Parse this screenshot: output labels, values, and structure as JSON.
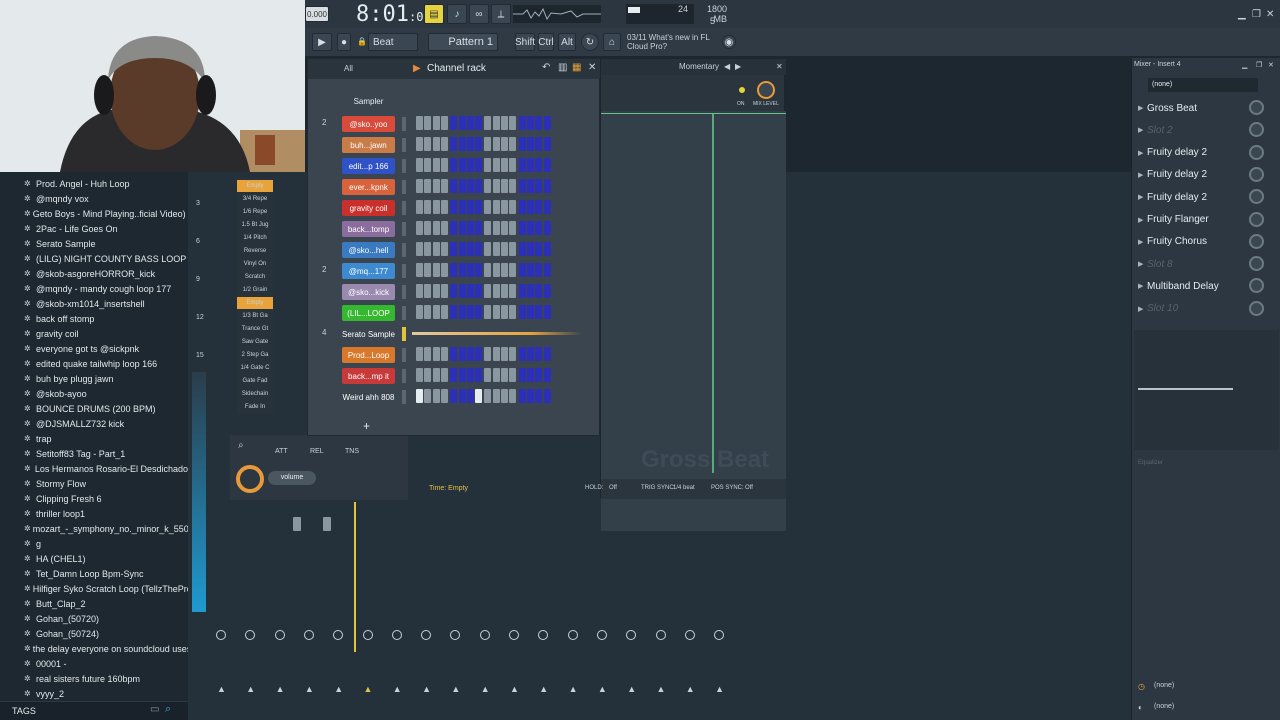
{
  "topbar": {
    "time": "8:01",
    "time_small": ":00",
    "tempo": "0.000",
    "cpu": "24",
    "ram": "1800 MB",
    "poly": "5",
    "news_date": "03/11",
    "news_text": "What's new in FL Cloud Pro?"
  },
  "toolbar": {
    "mode": "Beat",
    "pattern": "Pattern 1",
    "shift": "Shift",
    "ctrl": "Ctrl",
    "alt": "Alt"
  },
  "channel_rack": {
    "filter": "All",
    "title": "Channel rack",
    "sampler": "Sampler",
    "channels": [
      {
        "num": "2",
        "label": "@sko..yoo",
        "color": "#d84a3a"
      },
      {
        "num": "",
        "label": "buh...jawn",
        "color": "#c97b48"
      },
      {
        "num": "",
        "label": "edit...p 166",
        "color": "#2f52c8"
      },
      {
        "num": "",
        "label": "ever...kpnk",
        "color": "#d8623a"
      },
      {
        "num": "",
        "label": "gravity coil",
        "color": "#c9302c"
      },
      {
        "num": "",
        "label": "back...tomp",
        "color": "#8a6d9c"
      },
      {
        "num": "",
        "label": "@sko...hell",
        "color": "#3a7ac0"
      },
      {
        "num": "2",
        "label": "@mq...177",
        "color": "#3e8ad0"
      },
      {
        "num": "",
        "label": "@sko...kick",
        "color": "#9a8ab0"
      },
      {
        "num": "",
        "label": "(LIL...LOOP",
        "color": "#35b830"
      },
      {
        "num": "4",
        "label": "Serato Sample",
        "color": "#3a4550"
      },
      {
        "num": "",
        "label": "Prod...Loop",
        "color": "#d8782a"
      },
      {
        "num": "",
        "label": "back...mp it",
        "color": "#c83a3a"
      },
      {
        "num": "",
        "label": "Weird ahh 808",
        "color": "#3a4550"
      }
    ]
  },
  "side_effects": [
    "Empty",
    "3/4 Repe",
    "1/6 Repe",
    "1.5 Bt Jug",
    "1/4 Pitch",
    "Reverse",
    "Vinyl On",
    "Scratch",
    "1/2 Grain",
    "Empty",
    "1/3 Bt Ga",
    "Trance Gt",
    "Saw Gate",
    "2 Step Ga",
    "1/4 Gate C",
    "Gate Fad",
    "Sidechain",
    "Fade In"
  ],
  "envelope": {
    "att": "ATT",
    "rel": "REL",
    "tns": "TNS",
    "volume": "volume"
  },
  "grossbeat": {
    "header": "Momentary",
    "on": "ON",
    "mix": "MIX LEVEL",
    "watermark": "Gross Beat",
    "time": "Time: Empty",
    "hold_label": "HOLD:",
    "hold": "Off",
    "trig_label": "TRIG SYNC:",
    "trig": "1/4 beat",
    "pos_label": "POS SYNC:",
    "pos": "Off"
  },
  "mixer": {
    "title": "Mixer - Insert 4",
    "preset": "(none)",
    "slots": [
      {
        "label": "Gross Beat",
        "active": true
      },
      {
        "label": "Slot 2",
        "active": false
      },
      {
        "label": "Fruity delay 2",
        "active": true
      },
      {
        "label": "Fruity delay 2",
        "active": true
      },
      {
        "label": "Fruity delay 2",
        "active": true
      },
      {
        "label": "Fruity Flanger",
        "active": true
      },
      {
        "label": "Fruity Chorus",
        "active": true
      },
      {
        "label": "Slot 8",
        "active": false
      },
      {
        "label": "Multiband Delay",
        "active": true
      },
      {
        "label": "Slot 10",
        "active": false
      }
    ],
    "eq": "Equalizer",
    "out1": "(none)",
    "out2": "(none)"
  },
  "browser": {
    "footer": "TAGS",
    "items": [
      "Prod. Angel - Huh Loop",
      "@mqndy vox",
      "Geto Boys - Mind Playing..ficial Video) [Explicit]",
      "2Pac - Life Goes On",
      "Serato Sample",
      "(LILG) NIGHT COUNTY BASS LOOP",
      "@skob-asgoreHORROR_kick",
      "@mqndy - mandy cough loop 177",
      "@skob-xm1014_insertshell",
      "back off stomp",
      "gravity coil",
      "everyone got ts @sickpnk",
      "edited quake tailwhip loop 166",
      "buh bye plugg jawn",
      "@skob-ayoo",
      "BOUNCE DRUMS (200 BPM)",
      "@DJSMALLZ732 kick",
      "trap",
      "Setitoff83 Tag - Part_1",
      "Los Hermanos Rosario-El Desdichado",
      "Stormy Flow",
      "Clipping Fresh 6",
      "thriller loop1",
      "mozart_-_symphony_no._minor_k_550_complete",
      "g",
      "HA (CHEL1)",
      "Tet_Damn Loop Bpm-Sync",
      "Hilfiger Syko Scratch Loop (TellzTheProducer)_2",
      "Butt_Clap_2",
      "Gohan_(50720)",
      "Gohan_(50724)",
      "the delay everyone on soundcloud uses",
      "00001 -",
      "real sisters future 160bpm",
      "vyyy_2"
    ]
  },
  "mixer_strip_nums": [
    "3",
    "6",
    "9",
    "12",
    "15"
  ]
}
